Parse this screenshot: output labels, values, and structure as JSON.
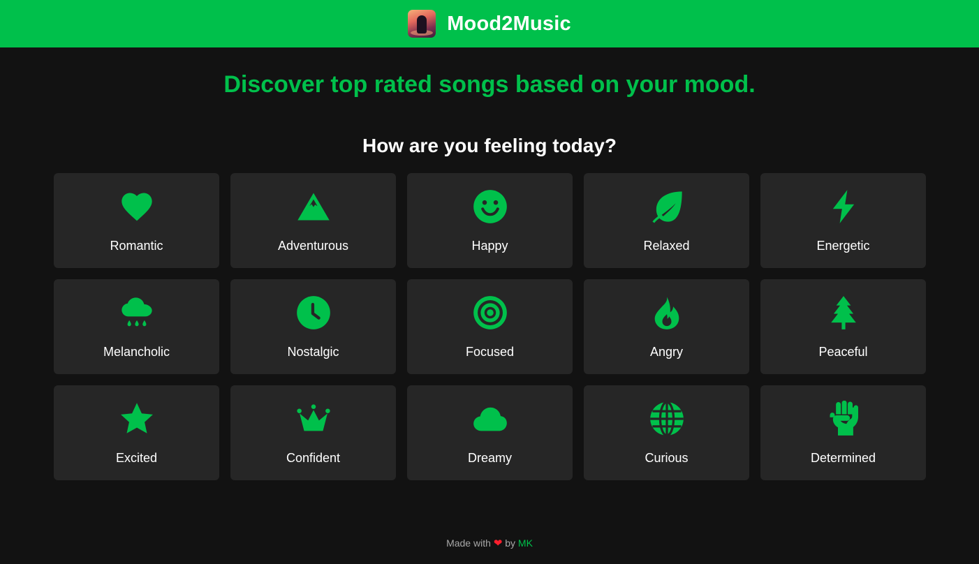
{
  "header": {
    "brand": "Mood2Music",
    "accent_color": "#00c04b",
    "logo_icon": "album-art-icon"
  },
  "hero": {
    "tagline": "Discover top rated songs based on your mood.",
    "question": "How are you feeling today?"
  },
  "moods": [
    {
      "label": "Romantic",
      "icon": "heart-icon"
    },
    {
      "label": "Adventurous",
      "icon": "mountain-icon"
    },
    {
      "label": "Happy",
      "icon": "smile-icon"
    },
    {
      "label": "Relaxed",
      "icon": "leaf-icon"
    },
    {
      "label": "Energetic",
      "icon": "lightning-icon"
    },
    {
      "label": "Melancholic",
      "icon": "rain-cloud-icon"
    },
    {
      "label": "Nostalgic",
      "icon": "clock-icon"
    },
    {
      "label": "Focused",
      "icon": "target-icon"
    },
    {
      "label": "Angry",
      "icon": "fire-icon"
    },
    {
      "label": "Peaceful",
      "icon": "tree-icon"
    },
    {
      "label": "Excited",
      "icon": "star-icon"
    },
    {
      "label": "Confident",
      "icon": "crown-icon"
    },
    {
      "label": "Dreamy",
      "icon": "cloud-icon"
    },
    {
      "label": "Curious",
      "icon": "globe-icon"
    },
    {
      "label": "Determined",
      "icon": "fist-icon"
    }
  ],
  "footer": {
    "made_with": "Made with",
    "heart": "❤",
    "by": "by",
    "author": "MK"
  }
}
